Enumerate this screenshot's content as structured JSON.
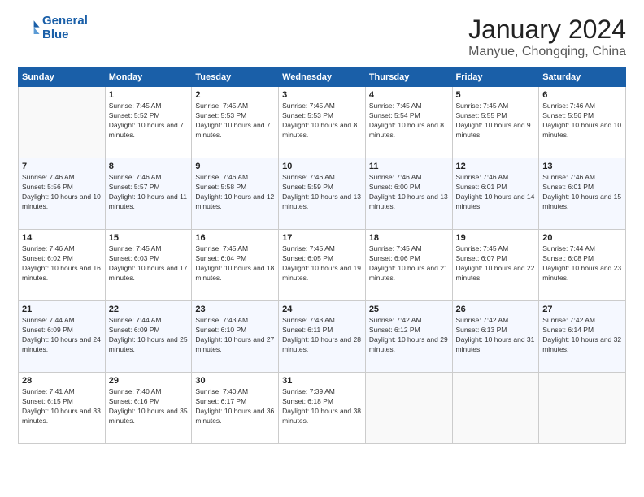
{
  "logo": {
    "line1": "General",
    "line2": "Blue"
  },
  "title": "January 2024",
  "location": "Manyue, Chongqing, China",
  "days_header": [
    "Sunday",
    "Monday",
    "Tuesday",
    "Wednesday",
    "Thursday",
    "Friday",
    "Saturday"
  ],
  "weeks": [
    [
      {
        "num": "",
        "sunrise": "",
        "sunset": "",
        "daylight": ""
      },
      {
        "num": "1",
        "sunrise": "7:45 AM",
        "sunset": "5:52 PM",
        "daylight": "10 hours and 7 minutes."
      },
      {
        "num": "2",
        "sunrise": "7:45 AM",
        "sunset": "5:53 PM",
        "daylight": "10 hours and 7 minutes."
      },
      {
        "num": "3",
        "sunrise": "7:45 AM",
        "sunset": "5:53 PM",
        "daylight": "10 hours and 8 minutes."
      },
      {
        "num": "4",
        "sunrise": "7:45 AM",
        "sunset": "5:54 PM",
        "daylight": "10 hours and 8 minutes."
      },
      {
        "num": "5",
        "sunrise": "7:45 AM",
        "sunset": "5:55 PM",
        "daylight": "10 hours and 9 minutes."
      },
      {
        "num": "6",
        "sunrise": "7:46 AM",
        "sunset": "5:56 PM",
        "daylight": "10 hours and 10 minutes."
      }
    ],
    [
      {
        "num": "7",
        "sunrise": "7:46 AM",
        "sunset": "5:56 PM",
        "daylight": "10 hours and 10 minutes."
      },
      {
        "num": "8",
        "sunrise": "7:46 AM",
        "sunset": "5:57 PM",
        "daylight": "10 hours and 11 minutes."
      },
      {
        "num": "9",
        "sunrise": "7:46 AM",
        "sunset": "5:58 PM",
        "daylight": "10 hours and 12 minutes."
      },
      {
        "num": "10",
        "sunrise": "7:46 AM",
        "sunset": "5:59 PM",
        "daylight": "10 hours and 13 minutes."
      },
      {
        "num": "11",
        "sunrise": "7:46 AM",
        "sunset": "6:00 PM",
        "daylight": "10 hours and 13 minutes."
      },
      {
        "num": "12",
        "sunrise": "7:46 AM",
        "sunset": "6:01 PM",
        "daylight": "10 hours and 14 minutes."
      },
      {
        "num": "13",
        "sunrise": "7:46 AM",
        "sunset": "6:01 PM",
        "daylight": "10 hours and 15 minutes."
      }
    ],
    [
      {
        "num": "14",
        "sunrise": "7:46 AM",
        "sunset": "6:02 PM",
        "daylight": "10 hours and 16 minutes."
      },
      {
        "num": "15",
        "sunrise": "7:45 AM",
        "sunset": "6:03 PM",
        "daylight": "10 hours and 17 minutes."
      },
      {
        "num": "16",
        "sunrise": "7:45 AM",
        "sunset": "6:04 PM",
        "daylight": "10 hours and 18 minutes."
      },
      {
        "num": "17",
        "sunrise": "7:45 AM",
        "sunset": "6:05 PM",
        "daylight": "10 hours and 19 minutes."
      },
      {
        "num": "18",
        "sunrise": "7:45 AM",
        "sunset": "6:06 PM",
        "daylight": "10 hours and 21 minutes."
      },
      {
        "num": "19",
        "sunrise": "7:45 AM",
        "sunset": "6:07 PM",
        "daylight": "10 hours and 22 minutes."
      },
      {
        "num": "20",
        "sunrise": "7:44 AM",
        "sunset": "6:08 PM",
        "daylight": "10 hours and 23 minutes."
      }
    ],
    [
      {
        "num": "21",
        "sunrise": "7:44 AM",
        "sunset": "6:09 PM",
        "daylight": "10 hours and 24 minutes."
      },
      {
        "num": "22",
        "sunrise": "7:44 AM",
        "sunset": "6:09 PM",
        "daylight": "10 hours and 25 minutes."
      },
      {
        "num": "23",
        "sunrise": "7:43 AM",
        "sunset": "6:10 PM",
        "daylight": "10 hours and 27 minutes."
      },
      {
        "num": "24",
        "sunrise": "7:43 AM",
        "sunset": "6:11 PM",
        "daylight": "10 hours and 28 minutes."
      },
      {
        "num": "25",
        "sunrise": "7:42 AM",
        "sunset": "6:12 PM",
        "daylight": "10 hours and 29 minutes."
      },
      {
        "num": "26",
        "sunrise": "7:42 AM",
        "sunset": "6:13 PM",
        "daylight": "10 hours and 31 minutes."
      },
      {
        "num": "27",
        "sunrise": "7:42 AM",
        "sunset": "6:14 PM",
        "daylight": "10 hours and 32 minutes."
      }
    ],
    [
      {
        "num": "28",
        "sunrise": "7:41 AM",
        "sunset": "6:15 PM",
        "daylight": "10 hours and 33 minutes."
      },
      {
        "num": "29",
        "sunrise": "7:40 AM",
        "sunset": "6:16 PM",
        "daylight": "10 hours and 35 minutes."
      },
      {
        "num": "30",
        "sunrise": "7:40 AM",
        "sunset": "6:17 PM",
        "daylight": "10 hours and 36 minutes."
      },
      {
        "num": "31",
        "sunrise": "7:39 AM",
        "sunset": "6:18 PM",
        "daylight": "10 hours and 38 minutes."
      },
      {
        "num": "",
        "sunrise": "",
        "sunset": "",
        "daylight": ""
      },
      {
        "num": "",
        "sunrise": "",
        "sunset": "",
        "daylight": ""
      },
      {
        "num": "",
        "sunrise": "",
        "sunset": "",
        "daylight": ""
      }
    ]
  ]
}
